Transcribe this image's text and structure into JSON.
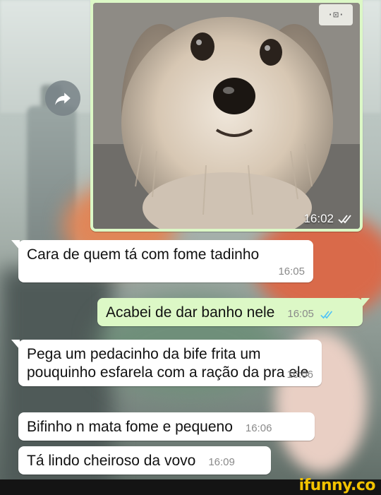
{
  "image_message": {
    "time": "16:02",
    "badge": "·⊡·",
    "status": "read"
  },
  "messages": [
    {
      "direction": "incoming",
      "text": "Cara de quem tá com fome tadinho",
      "time": "16:05"
    },
    {
      "direction": "outgoing",
      "text": "Acabei de dar banho nele",
      "time": "16:05",
      "status": "read"
    },
    {
      "direction": "incoming",
      "text": "Pega um pedacinho da bife frita um pouquinho esfarela com a ração da pra ele",
      "time": "16:06"
    },
    {
      "direction": "incoming",
      "text": "Bifinho n mata fome e pequeno",
      "time": "16:06"
    },
    {
      "direction": "incoming",
      "text": "Tá lindo cheiroso da vovo",
      "time": "16:09"
    }
  ],
  "watermark": "ifunny.co",
  "colors": {
    "outgoing_bubble": "#dcf8c6",
    "incoming_bubble": "#ffffff",
    "read_ticks": "#4fc3f7",
    "watermark": "#f2c200"
  }
}
